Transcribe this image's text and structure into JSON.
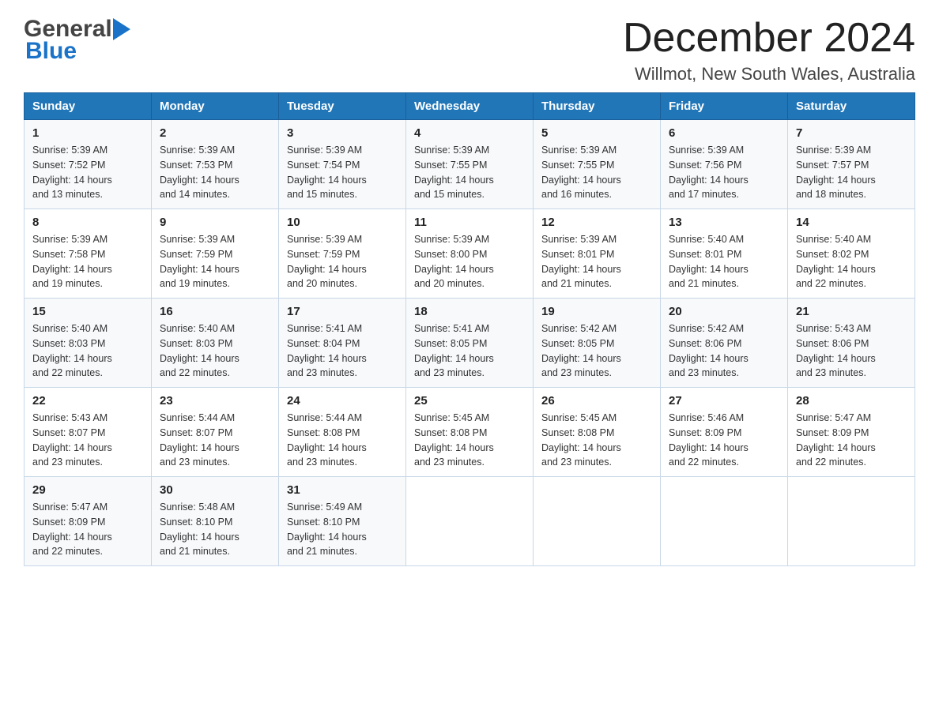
{
  "header": {
    "logo_general": "General",
    "logo_blue": "Blue",
    "title": "December 2024",
    "subtitle": "Willmot, New South Wales, Australia"
  },
  "days_of_week": [
    "Sunday",
    "Monday",
    "Tuesday",
    "Wednesday",
    "Thursday",
    "Friday",
    "Saturday"
  ],
  "weeks": [
    [
      {
        "day": "1",
        "sunrise": "5:39 AM",
        "sunset": "7:52 PM",
        "daylight": "14 hours and 13 minutes."
      },
      {
        "day": "2",
        "sunrise": "5:39 AM",
        "sunset": "7:53 PM",
        "daylight": "14 hours and 14 minutes."
      },
      {
        "day": "3",
        "sunrise": "5:39 AM",
        "sunset": "7:54 PM",
        "daylight": "14 hours and 15 minutes."
      },
      {
        "day": "4",
        "sunrise": "5:39 AM",
        "sunset": "7:55 PM",
        "daylight": "14 hours and 15 minutes."
      },
      {
        "day": "5",
        "sunrise": "5:39 AM",
        "sunset": "7:55 PM",
        "daylight": "14 hours and 16 minutes."
      },
      {
        "day": "6",
        "sunrise": "5:39 AM",
        "sunset": "7:56 PM",
        "daylight": "14 hours and 17 minutes."
      },
      {
        "day": "7",
        "sunrise": "5:39 AM",
        "sunset": "7:57 PM",
        "daylight": "14 hours and 18 minutes."
      }
    ],
    [
      {
        "day": "8",
        "sunrise": "5:39 AM",
        "sunset": "7:58 PM",
        "daylight": "14 hours and 19 minutes."
      },
      {
        "day": "9",
        "sunrise": "5:39 AM",
        "sunset": "7:59 PM",
        "daylight": "14 hours and 19 minutes."
      },
      {
        "day": "10",
        "sunrise": "5:39 AM",
        "sunset": "7:59 PM",
        "daylight": "14 hours and 20 minutes."
      },
      {
        "day": "11",
        "sunrise": "5:39 AM",
        "sunset": "8:00 PM",
        "daylight": "14 hours and 20 minutes."
      },
      {
        "day": "12",
        "sunrise": "5:39 AM",
        "sunset": "8:01 PM",
        "daylight": "14 hours and 21 minutes."
      },
      {
        "day": "13",
        "sunrise": "5:40 AM",
        "sunset": "8:01 PM",
        "daylight": "14 hours and 21 minutes."
      },
      {
        "day": "14",
        "sunrise": "5:40 AM",
        "sunset": "8:02 PM",
        "daylight": "14 hours and 22 minutes."
      }
    ],
    [
      {
        "day": "15",
        "sunrise": "5:40 AM",
        "sunset": "8:03 PM",
        "daylight": "14 hours and 22 minutes."
      },
      {
        "day": "16",
        "sunrise": "5:40 AM",
        "sunset": "8:03 PM",
        "daylight": "14 hours and 22 minutes."
      },
      {
        "day": "17",
        "sunrise": "5:41 AM",
        "sunset": "8:04 PM",
        "daylight": "14 hours and 23 minutes."
      },
      {
        "day": "18",
        "sunrise": "5:41 AM",
        "sunset": "8:05 PM",
        "daylight": "14 hours and 23 minutes."
      },
      {
        "day": "19",
        "sunrise": "5:42 AM",
        "sunset": "8:05 PM",
        "daylight": "14 hours and 23 minutes."
      },
      {
        "day": "20",
        "sunrise": "5:42 AM",
        "sunset": "8:06 PM",
        "daylight": "14 hours and 23 minutes."
      },
      {
        "day": "21",
        "sunrise": "5:43 AM",
        "sunset": "8:06 PM",
        "daylight": "14 hours and 23 minutes."
      }
    ],
    [
      {
        "day": "22",
        "sunrise": "5:43 AM",
        "sunset": "8:07 PM",
        "daylight": "14 hours and 23 minutes."
      },
      {
        "day": "23",
        "sunrise": "5:44 AM",
        "sunset": "8:07 PM",
        "daylight": "14 hours and 23 minutes."
      },
      {
        "day": "24",
        "sunrise": "5:44 AM",
        "sunset": "8:08 PM",
        "daylight": "14 hours and 23 minutes."
      },
      {
        "day": "25",
        "sunrise": "5:45 AM",
        "sunset": "8:08 PM",
        "daylight": "14 hours and 23 minutes."
      },
      {
        "day": "26",
        "sunrise": "5:45 AM",
        "sunset": "8:08 PM",
        "daylight": "14 hours and 23 minutes."
      },
      {
        "day": "27",
        "sunrise": "5:46 AM",
        "sunset": "8:09 PM",
        "daylight": "14 hours and 22 minutes."
      },
      {
        "day": "28",
        "sunrise": "5:47 AM",
        "sunset": "8:09 PM",
        "daylight": "14 hours and 22 minutes."
      }
    ],
    [
      {
        "day": "29",
        "sunrise": "5:47 AM",
        "sunset": "8:09 PM",
        "daylight": "14 hours and 22 minutes."
      },
      {
        "day": "30",
        "sunrise": "5:48 AM",
        "sunset": "8:10 PM",
        "daylight": "14 hours and 21 minutes."
      },
      {
        "day": "31",
        "sunrise": "5:49 AM",
        "sunset": "8:10 PM",
        "daylight": "14 hours and 21 minutes."
      },
      null,
      null,
      null,
      null
    ]
  ],
  "labels": {
    "sunrise": "Sunrise:",
    "sunset": "Sunset:",
    "daylight": "Daylight:"
  }
}
